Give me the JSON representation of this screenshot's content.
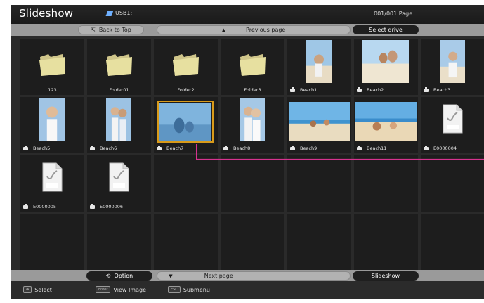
{
  "header": {
    "title": "Slideshow",
    "source": "USB1:",
    "page_info": "001/001 Page"
  },
  "nav": {
    "back": "Back to Top",
    "prev": "Previous page",
    "select_drive": "Select drive"
  },
  "items": [
    {
      "label": "123",
      "kind": "folder"
    },
    {
      "label": "Folder01",
      "kind": "folder"
    },
    {
      "label": "Folder2",
      "kind": "folder"
    },
    {
      "label": "Folder3",
      "kind": "folder"
    },
    {
      "label": "Beach1",
      "kind": "photo"
    },
    {
      "label": "Beach2",
      "kind": "photo"
    },
    {
      "label": "Beach3",
      "kind": "photo"
    },
    {
      "label": "Beach5",
      "kind": "photo"
    },
    {
      "label": "Beach6",
      "kind": "photo"
    },
    {
      "label": "Beach7",
      "kind": "photo",
      "selected": true
    },
    {
      "label": "Beach8",
      "kind": "photo"
    },
    {
      "label": "Beach9",
      "kind": "photo"
    },
    {
      "label": "Beach11",
      "kind": "photo"
    },
    {
      "label": "E0000004",
      "kind": "jpeg"
    },
    {
      "label": "E0000005",
      "kind": "jpeg"
    },
    {
      "label": "E0000006",
      "kind": "jpeg"
    }
  ],
  "footer": {
    "option": "Option",
    "next": "Next page",
    "slideshow": "Slideshow"
  },
  "help": {
    "select_key": "✥",
    "select": "Select",
    "enter_key": "Enter",
    "view": "View Image",
    "esc_key": "ESC",
    "submenu": "Submenu"
  },
  "colors": {
    "selection": "#d99b1a",
    "callout": "#d6338f",
    "folder": "#e7e0a0"
  }
}
